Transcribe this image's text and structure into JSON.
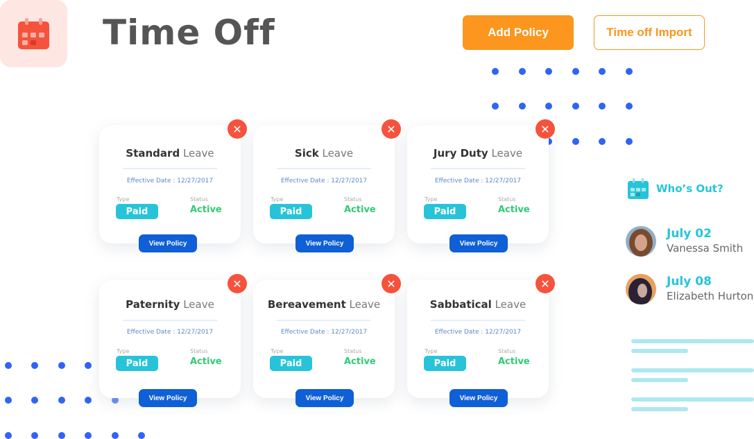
{
  "header": {
    "app_icon": "calendar-icon",
    "title": "Time Off",
    "add_policy_label": "Add Policy",
    "import_label": "Time off Import"
  },
  "colors": {
    "accent_orange": "#fc961e",
    "close_red": "#f5533d",
    "paid_teal": "#27c4d9",
    "active_green": "#2ecc71",
    "view_blue": "#0f5fd6",
    "dot_blue": "#2f64f5"
  },
  "policies": [
    {
      "name": "Standard",
      "suffix": "Leave",
      "effective": "Effective Date : 12/27/2017",
      "type_label": "Type",
      "type": "Paid",
      "status_label": "Status",
      "status": "Active",
      "view_label": "View Policy"
    },
    {
      "name": "Sick",
      "suffix": "Leave",
      "effective": "Effective Date : 12/27/2017",
      "type_label": "Type",
      "type": "Paid",
      "status_label": "Status",
      "status": "Active",
      "view_label": "View Policy"
    },
    {
      "name": "Jury Duty",
      "suffix": "Leave",
      "effective": "Effective Date : 12/27/2017",
      "type_label": "Type",
      "type": "Paid",
      "status_label": "Status",
      "status": "Active",
      "view_label": "View Policy"
    },
    {
      "name": "Paternity",
      "suffix": "Leave",
      "effective": "Effective Date : 12/27/2017",
      "type_label": "Type",
      "type": "Paid",
      "status_label": "Status",
      "status": "Active",
      "view_label": "View Policy"
    },
    {
      "name": "Bereavement",
      "suffix": "Leave",
      "effective": "Effective Date : 12/27/2017",
      "type_label": "Type",
      "type": "Paid",
      "status_label": "Status",
      "status": "Active",
      "view_label": "View Policy"
    },
    {
      "name": "Sabbatical",
      "suffix": "Leave",
      "effective": "Effective Date : 12/27/2017",
      "type_label": "Type",
      "type": "Paid",
      "status_label": "Status",
      "status": "Active",
      "view_label": "View Policy"
    }
  ],
  "close_glyph": "✕",
  "whos_out": {
    "label": "Who’s Out?",
    "people": [
      {
        "date": "July 02",
        "name": "Vanessa Smith"
      },
      {
        "date": "July 08",
        "name": "Elizabeth Hurton"
      }
    ]
  }
}
